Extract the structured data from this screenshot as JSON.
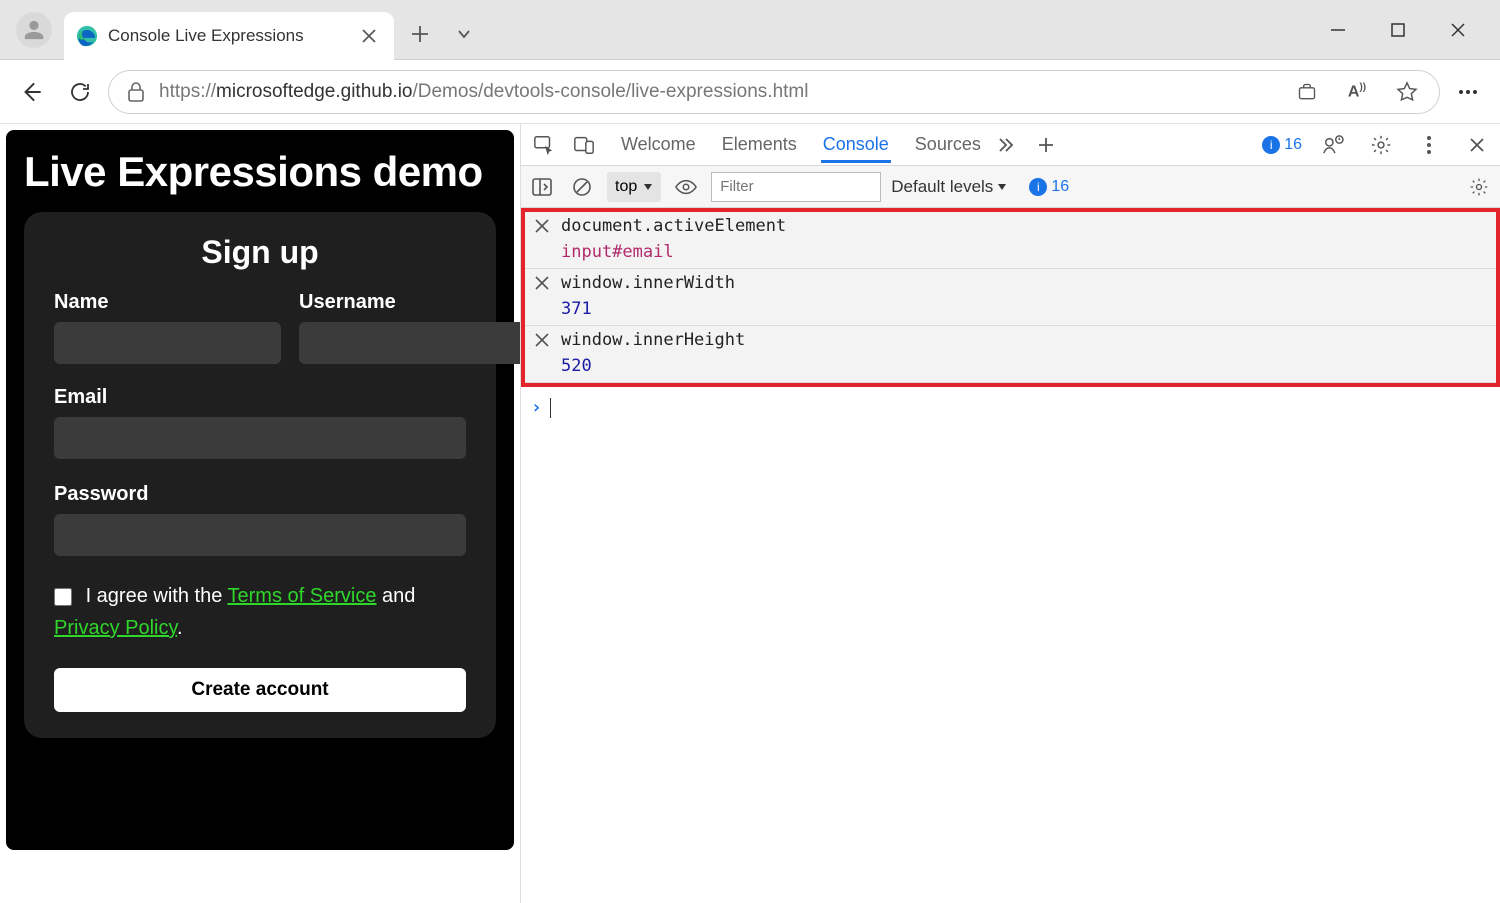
{
  "browser": {
    "tab_title": "Console Live Expressions",
    "url_prefix": "https://",
    "url_host": "microsoftedge.github.io",
    "url_path": "/Demos/devtools-console/live-expressions.html"
  },
  "page": {
    "heading": "Live Expressions demo",
    "form_title": "Sign up",
    "fields": {
      "name_label": "Name",
      "username_label": "Username",
      "email_label": "Email",
      "password_label": "Password"
    },
    "agree_pre": "I agree with the ",
    "agree_tos": "Terms of Service",
    "agree_mid": " and ",
    "agree_pp": "Privacy Policy",
    "agree_post": ".",
    "submit_label": "Create account"
  },
  "devtools": {
    "tabs": {
      "welcome": "Welcome",
      "elements": "Elements",
      "console": "Console",
      "sources": "Sources"
    },
    "issue_count_top": "16",
    "toolbar": {
      "context": "top",
      "filter_placeholder": "Filter",
      "levels_label": "Default levels",
      "issue_count": "16"
    },
    "live": [
      {
        "expr": "document.activeElement",
        "result": "input#email",
        "kind": "obj"
      },
      {
        "expr": "window.innerWidth",
        "result": "371",
        "kind": "num"
      },
      {
        "expr": "window.innerHeight",
        "result": "520",
        "kind": "num"
      }
    ]
  }
}
